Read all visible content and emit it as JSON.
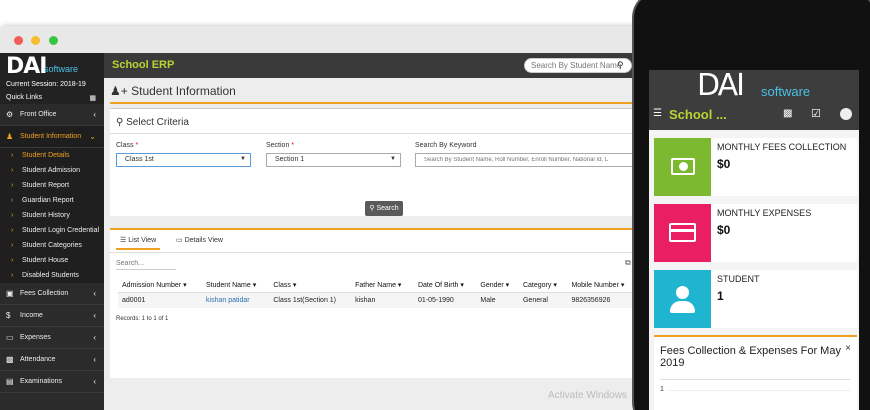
{
  "app": {
    "logo_big": "DAI",
    "logo_small": "software",
    "title": "School ERP",
    "search_placeholder": "Search By Student Name"
  },
  "sidebar": {
    "session": "Current Session: 2018-19",
    "quick_links": "Quick Links",
    "menu_top": [
      {
        "label": "Front Office"
      },
      {
        "label": "Student Information"
      }
    ],
    "sub_items": [
      {
        "label": "Student Details"
      },
      {
        "label": "Student Admission"
      },
      {
        "label": "Student Report"
      },
      {
        "label": "Guardian Report"
      },
      {
        "label": "Student History"
      },
      {
        "label": "Student Login Credential"
      },
      {
        "label": "Student Categories"
      },
      {
        "label": "Student House"
      },
      {
        "label": "Disabled Students"
      }
    ],
    "menu_bottom": [
      {
        "label": "Fees Collection"
      },
      {
        "label": "Income"
      },
      {
        "label": "Expenses"
      },
      {
        "label": "Attendance"
      },
      {
        "label": "Examinations"
      }
    ]
  },
  "page": {
    "title": "Student Information",
    "criteria_title": "Select Criteria"
  },
  "criteria": {
    "class_label": "Class",
    "class_value": "Class 1st",
    "section_label": "Section",
    "section_value": "Section 1",
    "keyword_label": "Search By Keyword",
    "keyword_placeholder": "Search By Student Name, Roll Number, Enroll Number, National Id, L",
    "search_button": "Search"
  },
  "list": {
    "tab_list": "List View",
    "tab_details": "Details View",
    "search_placeholder": "Search...",
    "columns": [
      "Admission Number",
      "Student Name",
      "Class",
      "Father Name",
      "Date Of Birth",
      "Gender",
      "Category",
      "Mobile Number"
    ],
    "rows": [
      [
        "ad0001",
        "kishan patidar",
        "Class 1st(Section 1)",
        "kishan",
        "01-05-1990",
        "Male",
        "General",
        "9826356926"
      ]
    ],
    "records": "Records: 1 to 1 of 1"
  },
  "watermark": {
    "line1": "Activate Windows"
  },
  "phone": {
    "logo_big": "DAI",
    "logo_small": "software",
    "title": "School ...",
    "cards": [
      {
        "label": "MONTHLY FEES COLLECTION",
        "value": "$0",
        "color": "#7cb830"
      },
      {
        "label": "MONTHLY EXPENSES",
        "value": "$0",
        "color": "#e91e63"
      },
      {
        "label": "STUDENT",
        "value": "1",
        "color": "#1fb5d0"
      }
    ],
    "chart_title": "Fees Collection & Expenses For May 2019",
    "chart_tick": "1"
  }
}
